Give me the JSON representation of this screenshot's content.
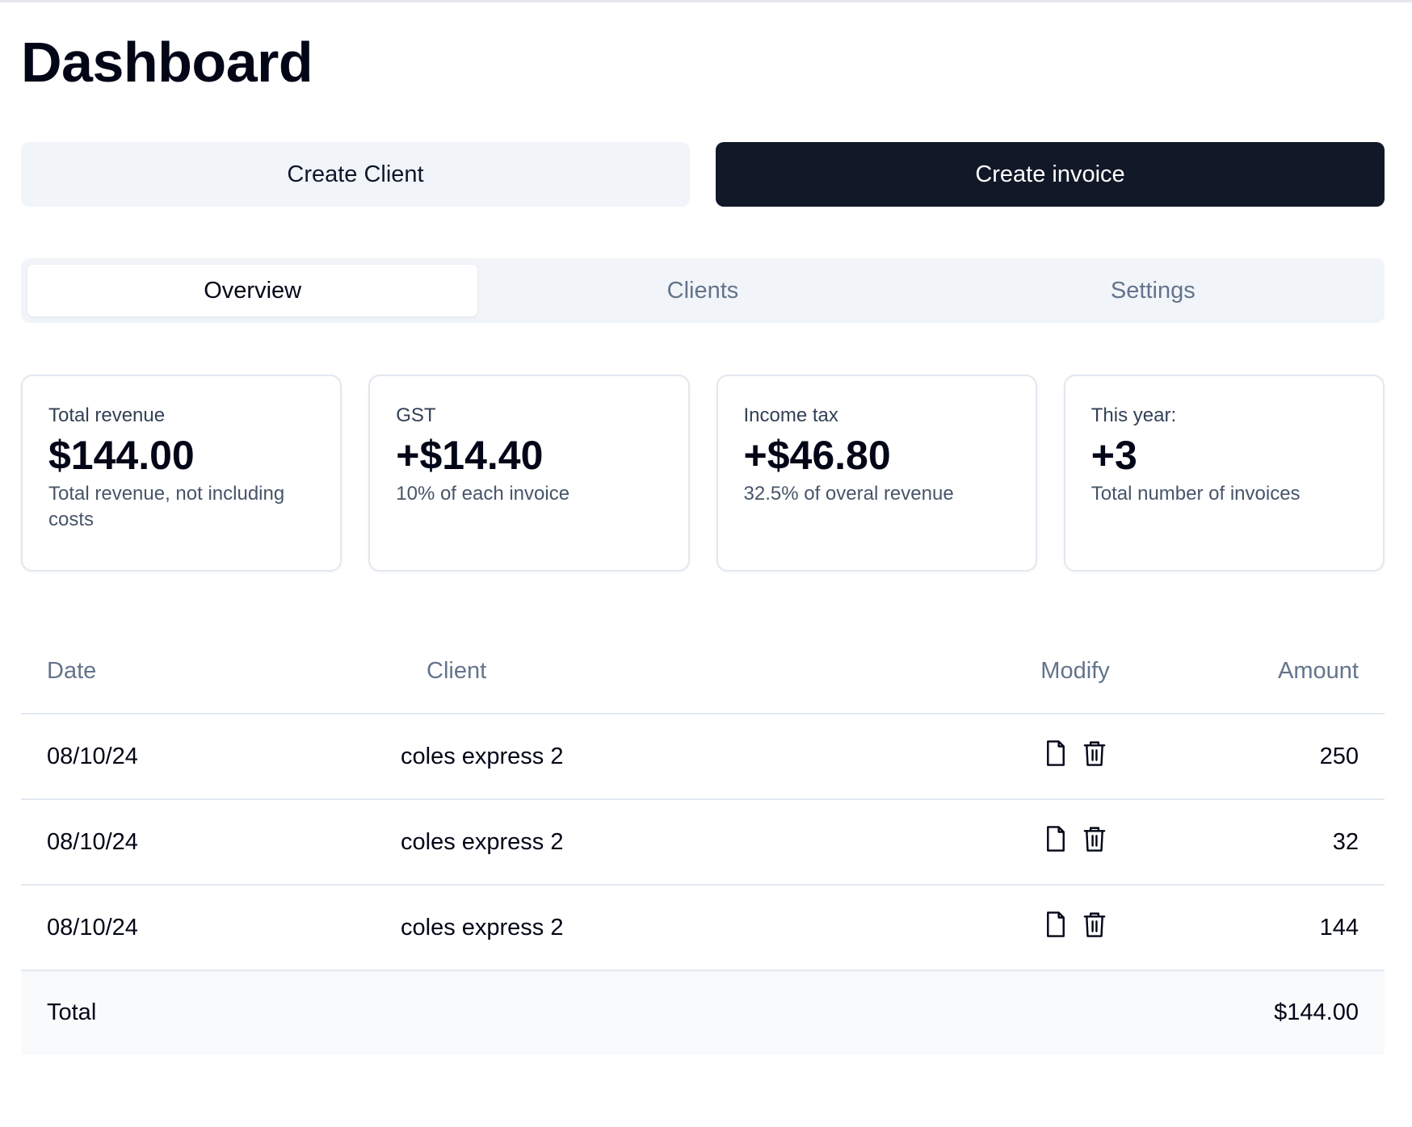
{
  "page": {
    "title": "Dashboard"
  },
  "actions": {
    "create_client": "Create Client",
    "create_invoice": "Create invoice"
  },
  "tabs": [
    {
      "label": "Overview",
      "active": true
    },
    {
      "label": "Clients",
      "active": false
    },
    {
      "label": "Settings",
      "active": false
    }
  ],
  "cards": [
    {
      "label": "Total revenue",
      "value": "$144.00",
      "desc": "Total revenue, not including costs"
    },
    {
      "label": "GST",
      "value": "+$14.40",
      "desc": "10% of each invoice"
    },
    {
      "label": "Income tax",
      "value": "+$46.80",
      "desc": "32.5% of overal revenue"
    },
    {
      "label": "This year:",
      "value": "+3",
      "desc": "Total number of invoices"
    }
  ],
  "table": {
    "headers": {
      "date": "Date",
      "client": "Client",
      "modify": "Modify",
      "amount": "Amount"
    },
    "rows": [
      {
        "date": "08/10/24",
        "client": "coles express 2",
        "amount": "250"
      },
      {
        "date": "08/10/24",
        "client": "coles express 2",
        "amount": "32"
      },
      {
        "date": "08/10/24",
        "client": "coles express 2",
        "amount": "144"
      }
    ],
    "footer": {
      "label": "Total",
      "amount": "$144.00"
    }
  },
  "icons": {
    "edit": "file-icon",
    "delete": "trash-icon"
  },
  "colors": {
    "primary": "#111827",
    "secondary_bg": "#f1f5f9",
    "muted_text": "#64748b",
    "border": "#e2e8f0"
  }
}
